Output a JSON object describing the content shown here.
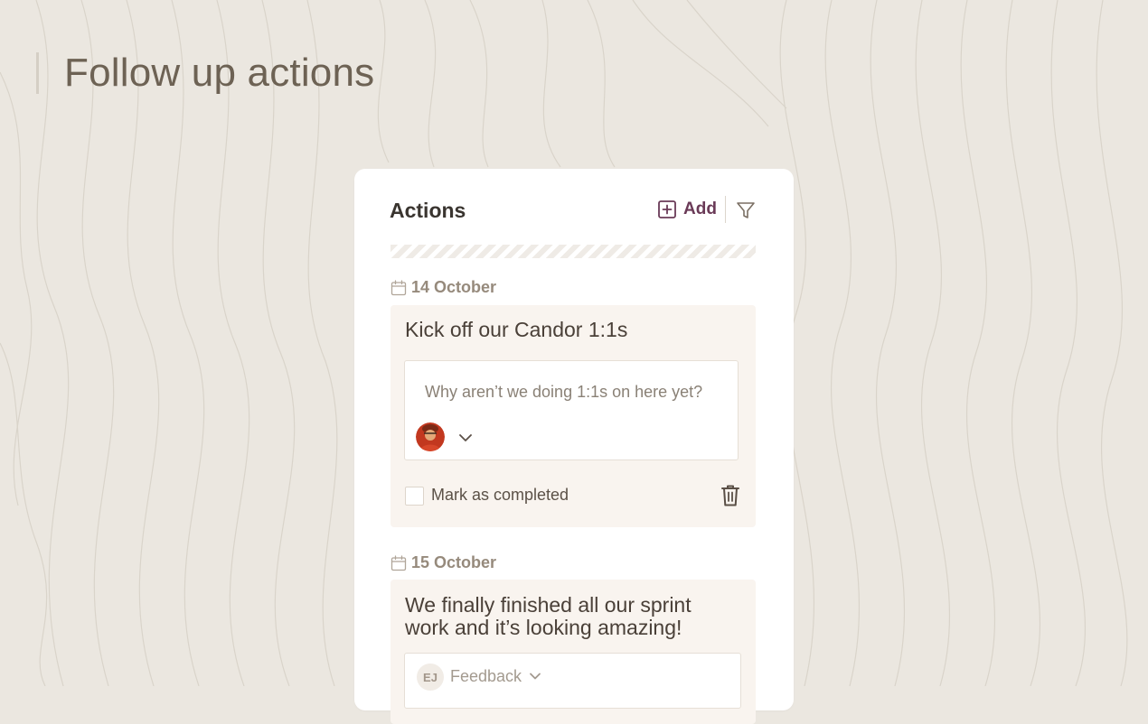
{
  "page": {
    "title": "Follow up actions"
  },
  "card": {
    "title": "Actions",
    "add_label": "Add",
    "icons": {
      "add": "plus-square-icon",
      "filter": "filter-icon",
      "calendar": "calendar-icon",
      "delete": "trash-icon",
      "chevron": "chevron-down-icon"
    }
  },
  "groups": [
    {
      "date": "14 October",
      "action": {
        "title": "Kick off our Candor 1:1s",
        "comment_placeholder": "Why aren’t we doing 1:1s on here yet?",
        "complete_label": "Mark as completed",
        "completed": false
      }
    },
    {
      "date": "15 October",
      "action": {
        "title_line1": "We finally finished all our sprint",
        "title_line2": "work and it’s looking amazing!",
        "assignee_initials": "EJ",
        "type_label": "Feedback"
      }
    }
  ],
  "colors": {
    "background": "#ebe7e0",
    "card": "#ffffff",
    "panel": "#f9f4ef",
    "accent": "#6a3a57",
    "muted": "#968a7c"
  }
}
